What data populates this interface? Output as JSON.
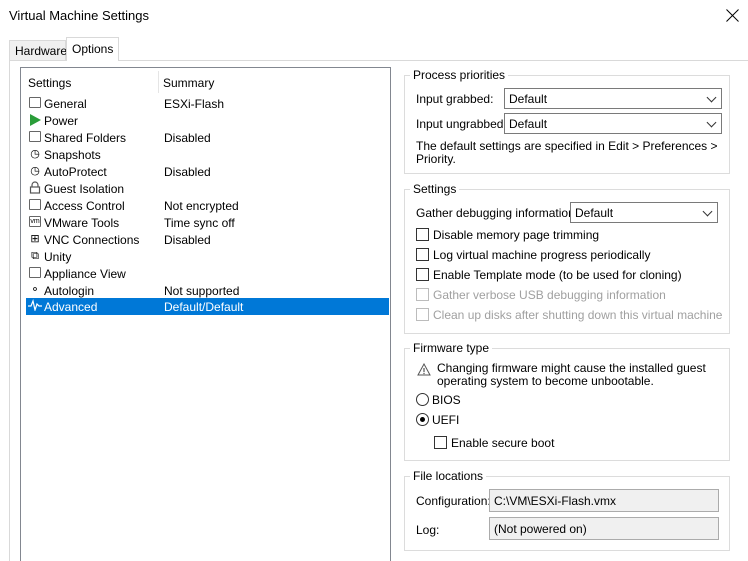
{
  "window": {
    "title": "Virtual Machine Settings"
  },
  "tabs": [
    {
      "label": "Hardware"
    },
    {
      "label": "Options"
    }
  ],
  "list": {
    "col_settings": "Settings",
    "col_summary": "Summary",
    "rows": [
      {
        "icon": "general-icon",
        "name": "General",
        "summary": "ESXi-Flash"
      },
      {
        "icon": "power-icon",
        "name": "Power",
        "summary": ""
      },
      {
        "icon": "shared-folders-icon",
        "name": "Shared Folders",
        "summary": "Disabled"
      },
      {
        "icon": "snapshots-icon",
        "name": "Snapshots",
        "summary": ""
      },
      {
        "icon": "autoprotect-icon",
        "name": "AutoProtect",
        "summary": "Disabled"
      },
      {
        "icon": "lock-icon",
        "name": "Guest Isolation",
        "summary": ""
      },
      {
        "icon": "access-control-icon",
        "name": "Access Control",
        "summary": "Not encrypted"
      },
      {
        "icon": "vmware-tools-icon",
        "name": "VMware Tools",
        "summary": "Time sync off"
      },
      {
        "icon": "vnc-icon",
        "name": "VNC Connections",
        "summary": "Disabled"
      },
      {
        "icon": "unity-icon",
        "name": "Unity",
        "summary": ""
      },
      {
        "icon": "appliance-icon",
        "name": "Appliance View",
        "summary": ""
      },
      {
        "icon": "autologin-icon",
        "name": "Autologin",
        "summary": "Not supported"
      },
      {
        "icon": "advanced-icon",
        "name": "Advanced",
        "summary": "Default/Default"
      }
    ],
    "selected": "Advanced"
  },
  "process_priorities": {
    "title": "Process priorities",
    "input_grabbed_label": "Input grabbed:",
    "input_grabbed_value": "Default",
    "input_ungrabbed_label": "Input ungrabbed:",
    "input_ungrabbed_value": "Default",
    "note_line1": "The default settings are specified in Edit > Preferences >",
    "note_line2": "Priority."
  },
  "settings": {
    "title": "Settings",
    "debug_label": "Gather debugging information:",
    "debug_value": "Default",
    "checkboxes": [
      {
        "label": "Disable memory page trimming",
        "checked": false,
        "enabled": true
      },
      {
        "label": "Log virtual machine progress periodically",
        "checked": false,
        "enabled": true
      },
      {
        "label": "Enable Template mode (to be used for cloning)",
        "checked": false,
        "enabled": true
      },
      {
        "label": "Gather verbose USB debugging information",
        "checked": false,
        "enabled": false
      },
      {
        "label": "Clean up disks after shutting down this virtual machine",
        "checked": false,
        "enabled": false
      }
    ]
  },
  "firmware": {
    "title": "Firmware type",
    "warning_line1": "Changing firmware might cause the installed guest",
    "warning_line2": "operating system to become unbootable.",
    "bios_label": "BIOS",
    "uefi_label": "UEFI",
    "selected": "UEFI",
    "secure_boot_label": "Enable secure boot",
    "secure_boot_checked": false
  },
  "files": {
    "title": "File locations",
    "config_label": "Configuration:",
    "config_value": "C:\\VM\\ESXi-Flash.vmx",
    "log_label": "Log:",
    "log_value": "(Not powered on)"
  },
  "colors": {
    "selection": "#0078d7",
    "power_green": "#2a9d3a"
  }
}
